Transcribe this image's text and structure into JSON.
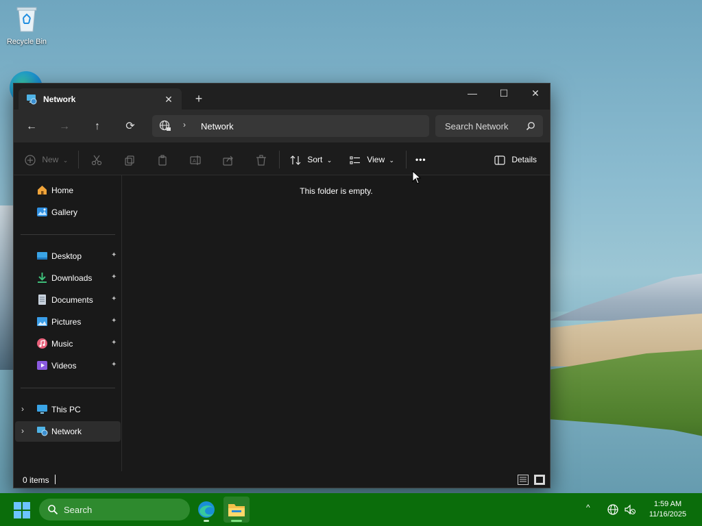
{
  "desktop": {
    "recycle_bin_label": "Recycle Bin"
  },
  "window": {
    "tab_title": "Network",
    "new_tab_symbol": "+",
    "tab_close_symbol": "✕",
    "caption": {
      "minimize": "—",
      "maximize": "☐",
      "close": "✕"
    }
  },
  "navigation": {
    "back": "←",
    "forward": "→",
    "up": "↑",
    "refresh": "⟳",
    "chevron": "›",
    "breadcrumb": "Network",
    "search_placeholder": "Search Network"
  },
  "commandbar": {
    "new_label": "New",
    "sort_label": "Sort",
    "view_label": "View",
    "more_label": "•••",
    "details_label": "Details"
  },
  "sidebar": {
    "items": [
      {
        "label": "Home",
        "icon": "home-icon"
      },
      {
        "label": "Gallery",
        "icon": "gallery-icon"
      },
      {
        "label": "Desktop",
        "icon": "desktop-folder-icon",
        "pinned": true
      },
      {
        "label": "Downloads",
        "icon": "downloads-icon",
        "pinned": true
      },
      {
        "label": "Documents",
        "icon": "documents-icon",
        "pinned": true
      },
      {
        "label": "Pictures",
        "icon": "pictures-icon",
        "pinned": true
      },
      {
        "label": "Music",
        "icon": "music-icon",
        "pinned": true
      },
      {
        "label": "Videos",
        "icon": "videos-icon",
        "pinned": true
      },
      {
        "label": "This PC",
        "icon": "this-pc-icon",
        "expandable": true
      },
      {
        "label": "Network",
        "icon": "network-icon",
        "expandable": true,
        "selected": true
      }
    ],
    "pin_symbol": "📌",
    "expand_symbol": "›"
  },
  "content": {
    "empty_message": "This folder is empty."
  },
  "statusbar": {
    "item_count": "0 items"
  },
  "taskbar": {
    "search_label": "Search",
    "tray_overflow": "^",
    "time": "1:59 AM",
    "date": "11/16/2025",
    "accent": "#0b6d0b"
  }
}
